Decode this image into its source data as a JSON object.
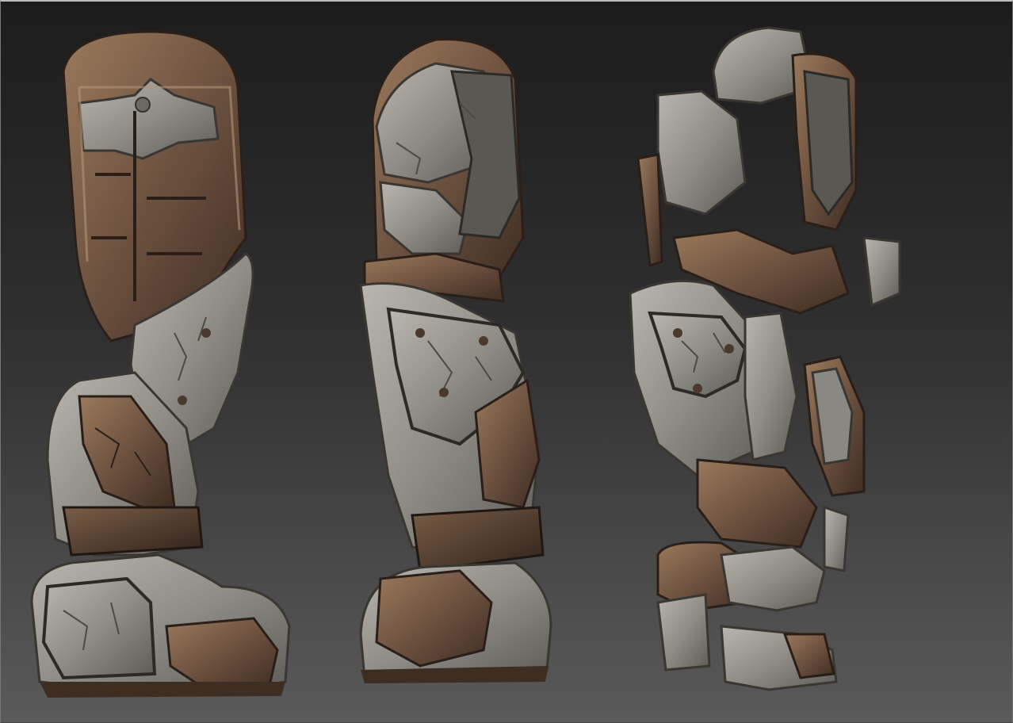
{
  "scene": {
    "description_key": "zbrush-viewport",
    "background_colors": {
      "top": "#1c1c1c",
      "bottom": "#5a5a5a"
    },
    "material_colors": {
      "stone": "#8e8c86",
      "stone_light": "#b3b1aa",
      "stone_dark": "#5c5a55",
      "leather": "#6e5340",
      "leather_light": "#97765a",
      "leather_dark": "#3f2e22",
      "rivet": "#4a3a2e"
    },
    "models": [
      {
        "view": "front"
      },
      {
        "view": "side"
      },
      {
        "view": "exploded"
      }
    ]
  }
}
